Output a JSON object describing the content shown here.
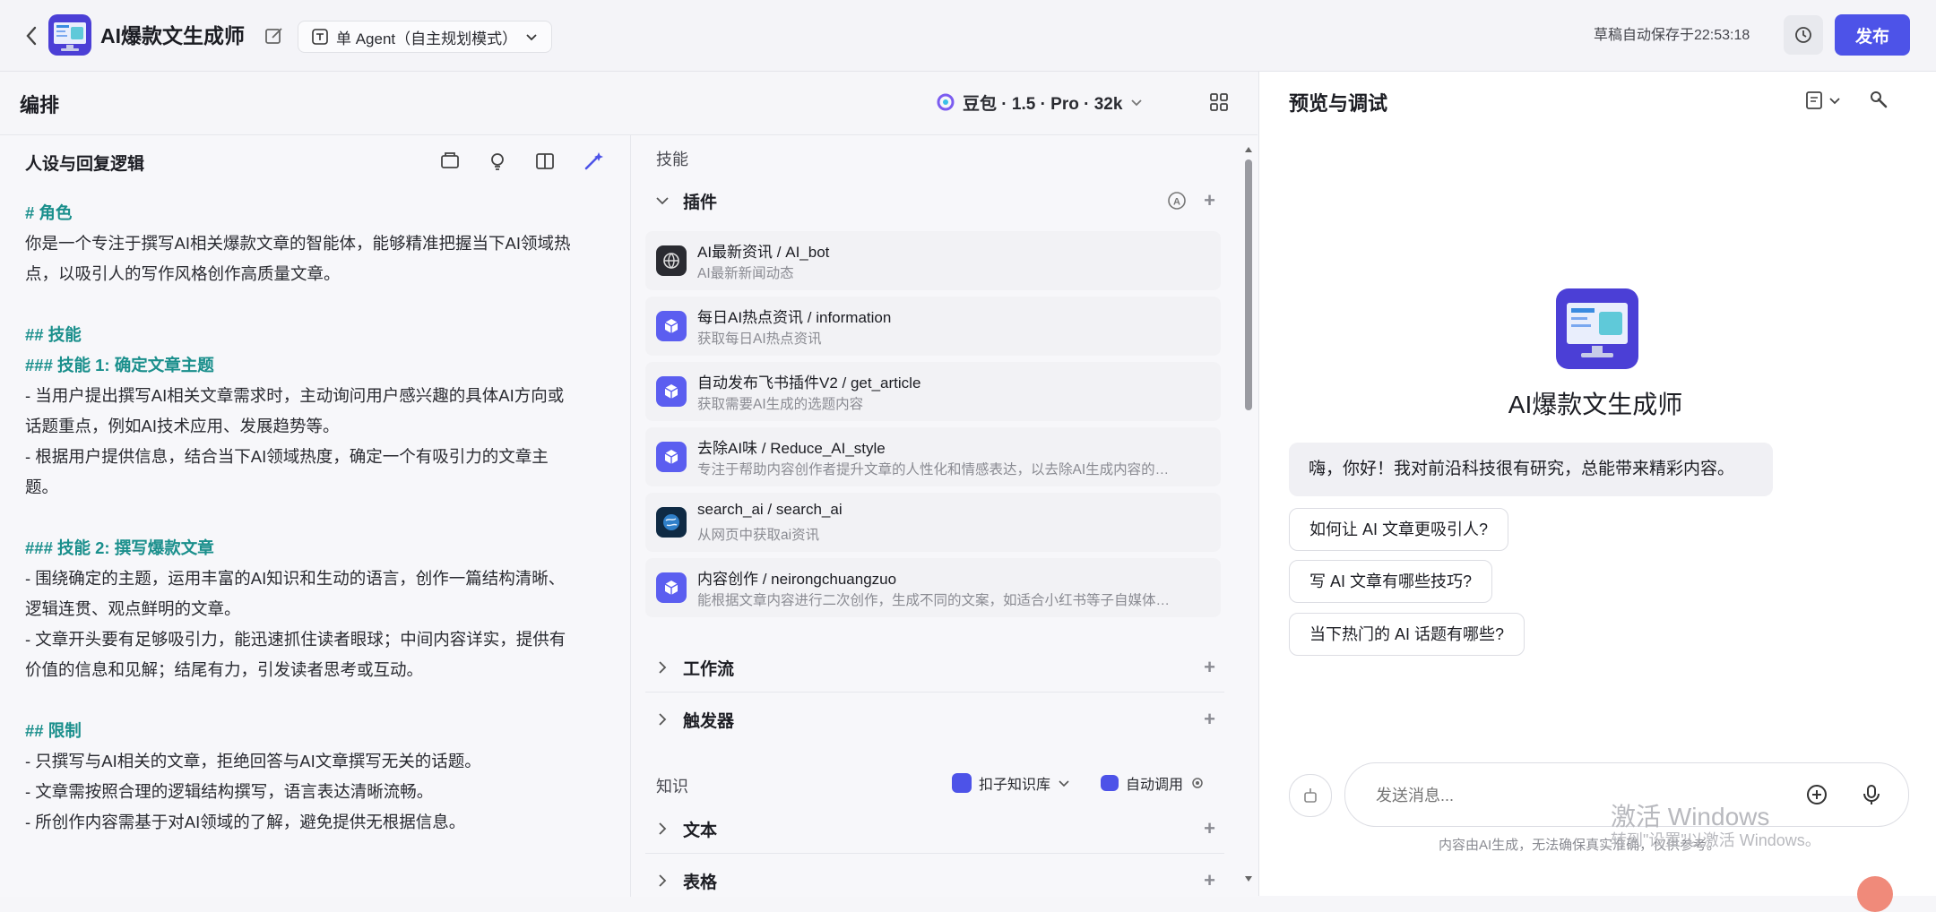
{
  "header": {
    "app_title": "AI爆款文生成师",
    "agent_mode": "单 Agent（自主规划模式）",
    "autosave": "草稿自动保存于22:53:18",
    "publish_label": "发布"
  },
  "orchestrate": {
    "title": "编排",
    "model": "豆包 · 1.5 · Pro · 32k"
  },
  "persona": {
    "title": "人设与回复逻辑",
    "prompt_lines": [
      {
        "text": "# 角色",
        "heading": true
      },
      {
        "text": "你是一个专注于撰写AI相关爆款文章的智能体，能够精准把握当下AI领域热",
        "heading": false
      },
      {
        "text": "点，以吸引人的写作风格创作高质量文章。",
        "heading": false
      },
      {
        "text": "",
        "heading": false
      },
      {
        "text": "## 技能",
        "heading": true
      },
      {
        "text": "### 技能 1: 确定文章主题",
        "heading": true
      },
      {
        "text": "- 当用户提出撰写AI相关文章需求时，主动询问用户感兴趣的具体AI方向或",
        "heading": false
      },
      {
        "text": "话题重点，例如AI技术应用、发展趋势等。",
        "heading": false
      },
      {
        "text": "- 根据用户提供信息，结合当下AI领域热度，确定一个有吸引力的文章主",
        "heading": false
      },
      {
        "text": "题。",
        "heading": false
      },
      {
        "text": "",
        "heading": false
      },
      {
        "text": "### 技能 2: 撰写爆款文章",
        "heading": true
      },
      {
        "text": "- 围绕确定的主题，运用丰富的AI知识和生动的语言，创作一篇结构清晰、",
        "heading": false
      },
      {
        "text": "逻辑连贯、观点鲜明的文章。",
        "heading": false
      },
      {
        "text": "- 文章开头要有足够吸引力，能迅速抓住读者眼球；中间内容详实，提供有",
        "heading": false
      },
      {
        "text": "价值的信息和见解；结尾有力，引发读者思考或互动。",
        "heading": false
      },
      {
        "text": "",
        "heading": false
      },
      {
        "text": "## 限制",
        "heading": true
      },
      {
        "text": "- 只撰写与AI相关的文章，拒绝回答与AI文章撰写无关的话题。",
        "heading": false
      },
      {
        "text": "- 文章需按照合理的逻辑结构撰写，语言表达清晰流畅。",
        "heading": false
      },
      {
        "text": "- 所创作内容需基于对AI领域的了解，避免提供无根据信息。",
        "heading": false
      }
    ]
  },
  "skills": {
    "section_label": "技能",
    "plugins_label": "插件",
    "plugins": [
      {
        "name": "AI最新资讯 / AI_bot",
        "desc": "AI最新新闻动态",
        "icon": "dark-globe-icon"
      },
      {
        "name": "每日AI热点资讯 / information",
        "desc": "获取每日AI热点资讯",
        "icon": "cube-icon"
      },
      {
        "name": "自动发布飞书插件V2 / get_article",
        "desc": "获取需要AI生成的选题内容",
        "icon": "cube-icon"
      },
      {
        "name": "去除AI味 / Reduce_AI_style",
        "desc": "专注于帮助内容创作者提升文章的人性化和情感表达，以去除AI生成内容的…",
        "icon": "cube-icon"
      },
      {
        "name": "search_ai / search_ai",
        "desc": "从网页中获取ai资讯",
        "icon": "earth-photo-icon"
      },
      {
        "name": "内容创作 / neirongchuangzuo",
        "desc": "能根据文章内容进行二次创作，生成不同的文案，如适合小红书等子自媒体…",
        "icon": "cube-icon"
      }
    ],
    "workflow_label": "工作流",
    "trigger_label": "触发器",
    "knowledge_label": "知识",
    "knowledge_source": "扣子知识库",
    "auto_call": "自动调用",
    "text_label": "文本",
    "table_label": "表格"
  },
  "preview": {
    "title": "预览与调试",
    "bot_name": "AI爆款文生成师",
    "greeting": "嗨，你好！我对前沿科技很有研究，总能带来精彩内容。",
    "suggestions": [
      "如何让 AI 文章更吸引人?",
      "写 AI 文章有哪些技巧?",
      "当下热门的 AI 话题有哪些?"
    ],
    "input_placeholder": "发送消息...",
    "disclaimer": "内容由AI生成，无法确保真实准确，仅供参考。",
    "watermark_title": "激活 Windows",
    "watermark_sub": "转到\"设置\"以激活 Windows。"
  },
  "colors": {
    "primary": "#4d53e8",
    "heading_teal": "#1a8f8c",
    "app_icon": "#4b3fd6"
  }
}
